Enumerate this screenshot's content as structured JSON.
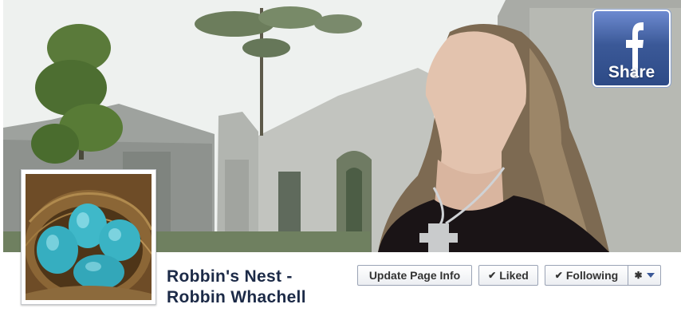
{
  "page": {
    "title_line1": "Robbin's Nest -",
    "title_line2": "Robbin Whachell"
  },
  "actions": {
    "update_label": "Update Page Info",
    "liked_label": "Liked",
    "following_label": "Following"
  },
  "share": {
    "label": "Share",
    "brand_color": "#3b5998"
  },
  "icons": {
    "check": "check-icon",
    "gear": "gear-icon",
    "dropdown": "caret-down-icon",
    "facebook": "facebook-f-icon"
  }
}
